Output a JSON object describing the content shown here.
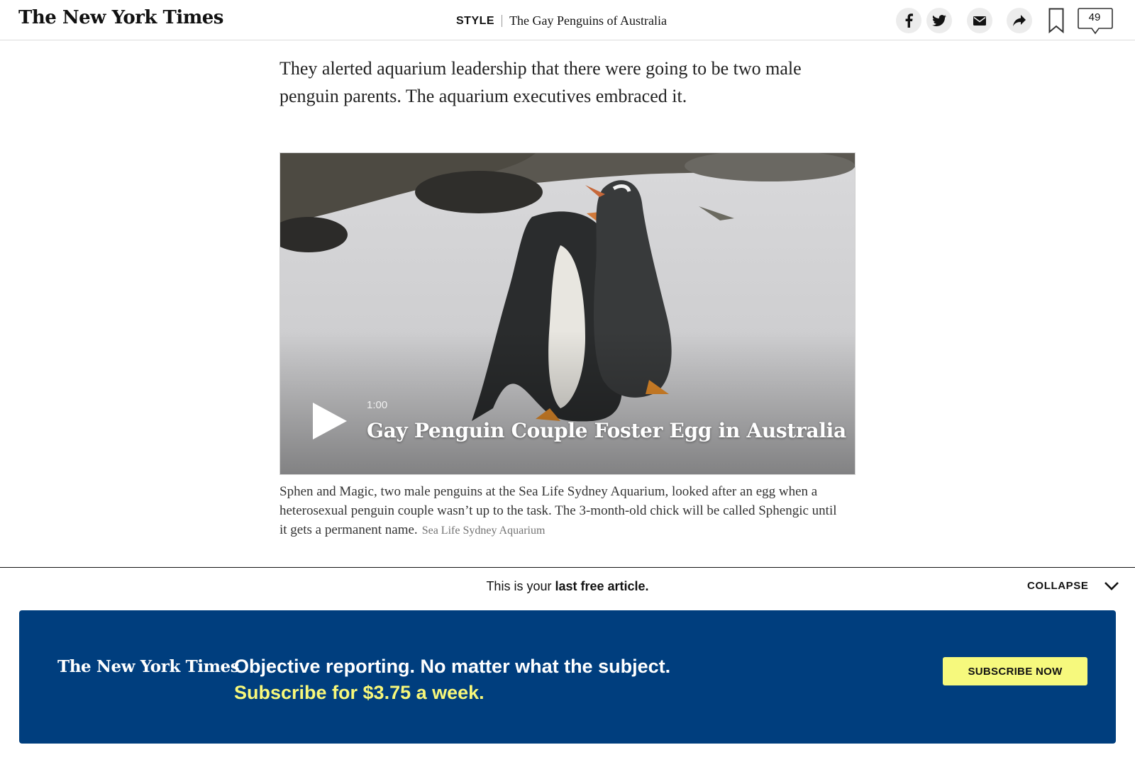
{
  "header": {
    "logo": "The New York Times",
    "section": "STYLE",
    "headline": "The Gay Penguins of Australia",
    "share_icons": [
      "facebook-icon",
      "twitter-icon",
      "email-icon",
      "share-icon"
    ],
    "comment_count": "49"
  },
  "article": {
    "body_text": "They alerted aquarium leadership that there were going to be two male penguin parents. The aquarium executives embraced it."
  },
  "video": {
    "duration": "1:00",
    "title": "Gay Penguin Couple Foster Egg in Australia"
  },
  "caption": {
    "text": "Sphen and Magic, two male penguins at the Sea Life Sydney Aquarium, looked after an egg when a heterosexual penguin couple wasn’t up to the task. The 3-month-old chick will be called Sphengic until it gets a permanent name.",
    "credit": "Sea Life Sydney Aquarium"
  },
  "gateway": {
    "note_prefix": "This is your ",
    "note_bold": "last free article.",
    "collapse_label": "COLLAPSE"
  },
  "promo": {
    "logo": "The New York Times",
    "line1": "Objective reporting. No matter what the subject.",
    "line2": "Subscribe for $3.75 a week.",
    "button_label": "SUBSCRIBE NOW",
    "colors": {
      "background": "#003e7e",
      "accent": "#f8f87a"
    }
  }
}
